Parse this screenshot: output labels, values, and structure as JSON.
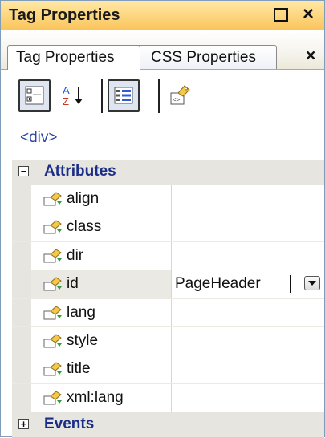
{
  "window": {
    "title": "Tag Properties",
    "maximize_icon": "square-icon",
    "close_glyph": "×"
  },
  "tabs": [
    {
      "label": "Tag Properties",
      "active": true
    },
    {
      "label": "CSS Properties",
      "active": false
    }
  ],
  "tab_close_glyph": "×",
  "toolbar": {
    "buttons": [
      {
        "icon": "categorized-icon",
        "pressed": true
      },
      {
        "icon": "sort-alphabetical-icon",
        "pressed": false
      },
      {
        "icon": "show-set-properties-icon",
        "pressed": true
      },
      {
        "icon": "tag-icon",
        "pressed": false
      }
    ]
  },
  "current_tag": "<div>",
  "grid": {
    "categories": [
      {
        "label": "Attributes",
        "expanded": true,
        "expander_glyph": "−",
        "properties": [
          {
            "name": "align",
            "value": ""
          },
          {
            "name": "class",
            "value": ""
          },
          {
            "name": "dir",
            "value": ""
          },
          {
            "name": "id",
            "value": "PageHeader",
            "selected": true
          },
          {
            "name": "lang",
            "value": ""
          },
          {
            "name": "style",
            "value": ""
          },
          {
            "name": "title",
            "value": ""
          },
          {
            "name": "xml:lang",
            "value": ""
          }
        ]
      },
      {
        "label": "Events",
        "expanded": false,
        "expander_glyph": "+",
        "properties": []
      }
    ]
  },
  "colors": {
    "title_gradient_top": "#ffe8a6",
    "title_gradient_bottom": "#fbc55c",
    "category_label": "#1b2e87",
    "current_tag": "#2c47a6"
  }
}
